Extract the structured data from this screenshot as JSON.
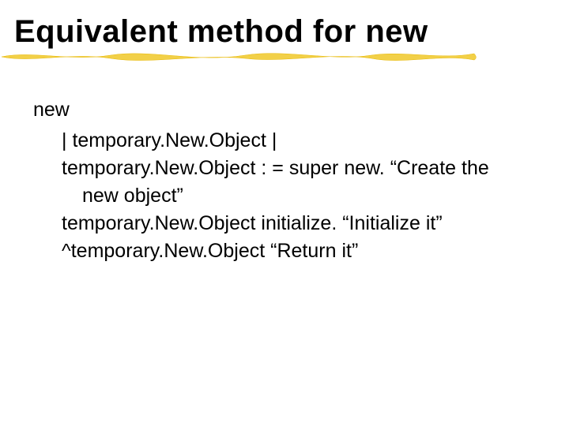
{
  "title": "Equivalent method for new",
  "method": "new",
  "code": {
    "l1": "| temporary.New.Object |",
    "l2a": "temporary.New.Object : = super new. “Create the",
    "l2b": "new object”",
    "l3": "temporary.New.Object initialize. “Initialize it”",
    "l4": "^temporary.New.Object “Return it”"
  }
}
